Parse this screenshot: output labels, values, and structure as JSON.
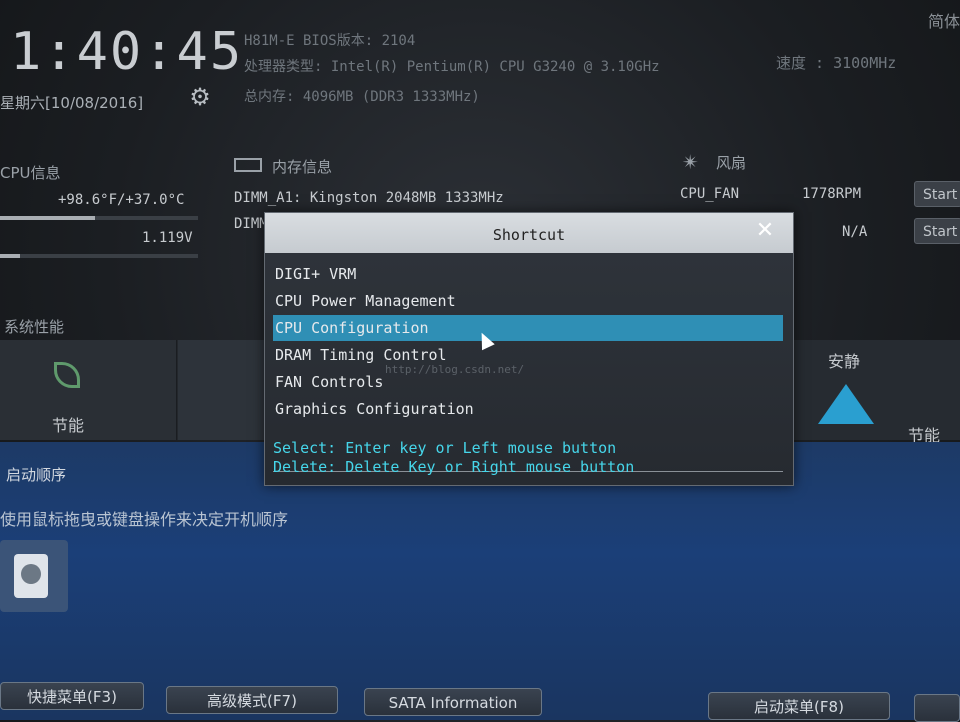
{
  "header": {
    "time": "1:40:45",
    "date": "星期六[10/08/2016]",
    "board_line": "H81M-E   BIOS版本: 2104",
    "cpu_type_line": "处理器类型: Intel(R) Pentium(R) CPU G3240 @ 3.10GHz",
    "speed_line": "速度 : 3100MHz",
    "memory_line": "总内存: 4096MB (DDR3 1333MHz)",
    "language": "简体",
    "settings_icon": "gear-icon"
  },
  "cpu_info": {
    "title": "CPU信息",
    "temperature": "+98.6°F/+37.0°C",
    "voltage": "1.119V",
    "temp_level": 0.37,
    "volt_level": 0.08
  },
  "memory_info": {
    "title": "内存信息",
    "icon": "memory-icon",
    "dimm_a1": "DIMM_A1: Kingston 2048MB 1333MHz",
    "dimm_partial": "DIMM"
  },
  "fan_info": {
    "title": "风扇",
    "icon": "fan-icon",
    "fans": [
      {
        "name": "CPU_FAN",
        "rpm": "1778RPM",
        "button": "Start"
      },
      {
        "name": "",
        "rpm": "N/A",
        "button": "Start"
      }
    ]
  },
  "performance": {
    "title": "系统性能",
    "modes": [
      {
        "label": "节能",
        "icon": "leaf-icon"
      },
      {
        "label": "安静",
        "icon": "triangle-icon"
      }
    ],
    "quiet_sub": "节能"
  },
  "boot": {
    "title": "启动顺序",
    "description": "使用鼠标拖曳或键盘操作来决定开机顺序",
    "drive_icon": "hard-drive-icon"
  },
  "bottom_buttons": [
    "快捷菜单(F3)",
    "高级模式(F7)",
    "SATA Information",
    "启动菜单(F8)"
  ],
  "dialog": {
    "title": "Shortcut",
    "close_icon": "close-icon",
    "items": [
      "DIGI+ VRM",
      "CPU Power Management",
      "CPU Configuration",
      "DRAM Timing Control",
      "FAN Controls",
      "Graphics Configuration"
    ],
    "selected_index": 2,
    "hint_select": "Select: Enter key or Left mouse button",
    "hint_delete": "Delete: Delete Key or Right mouse button",
    "watermark": "http://blog.csdn.net/"
  },
  "colors": {
    "selection": "#2f8fb5",
    "hint_text": "#46d6ea",
    "blue_panel": "#1b3f78"
  }
}
